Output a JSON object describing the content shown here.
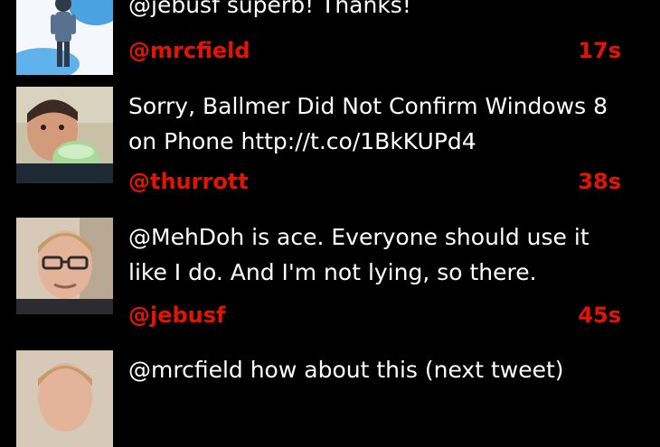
{
  "colors": {
    "background": "#000000",
    "text": "#ffffff",
    "accent": "#e51400"
  },
  "tweets": [
    {
      "text": "@jebusf superb! Thanks!",
      "handle": "@mrcfield",
      "age": "17s",
      "avatar": "avatar-mrcfield"
    },
    {
      "text": "Sorry, Ballmer Did Not Confirm Windows 8 on Phone http://t.co/1BkKUPd4",
      "handle": "@thurrott",
      "age": "38s",
      "avatar": "avatar-thurrott"
    },
    {
      "text": "@MehDoh is ace. Everyone should use it like I do. And I'm not lying, so there.",
      "handle": "@jebusf",
      "age": "45s",
      "avatar": "avatar-jebusf"
    },
    {
      "text": "@mrcfield how about this (next tweet)",
      "handle": "",
      "age": "",
      "avatar": "avatar-jebusf"
    }
  ]
}
